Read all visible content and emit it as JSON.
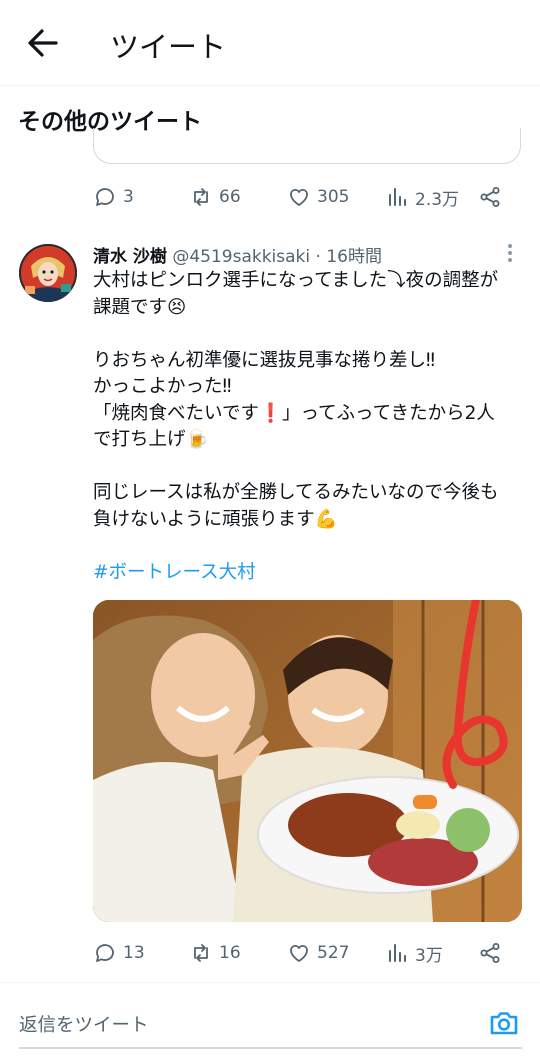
{
  "header": {
    "title": "ツイート"
  },
  "section_title": "その他のツイート",
  "prev_tweet": {
    "stats": {
      "replies": "3",
      "retweets": "66",
      "likes": "305",
      "views": "2.3万"
    }
  },
  "tweet": {
    "author_name": "清水 沙樹",
    "handle": "@4519sakkisaki",
    "time": "16時間",
    "lines": [
      "大村はピンロク選手になってました⤵夜の調整が",
      "課題です😣",
      "",
      "りおちゃん初準優に選抜見事な捲り差し‼",
      "かっこよかった‼",
      "「焼肉食べたいです❗」ってふってきたから2人",
      "で打ち上げ🍺",
      "",
      "同じレースは私が全勝してるみたいなので今後も",
      "負けないように頑張ります💪"
    ],
    "hashtag": "#ボートレース大村",
    "stats": {
      "replies": "13",
      "retweets": "16",
      "likes": "527",
      "views": "3万"
    }
  },
  "reply_bar": {
    "placeholder": "返信をツイート"
  },
  "colors": {
    "accent": "#1d9bf0",
    "muted": "#536471",
    "text": "#0f1419"
  }
}
